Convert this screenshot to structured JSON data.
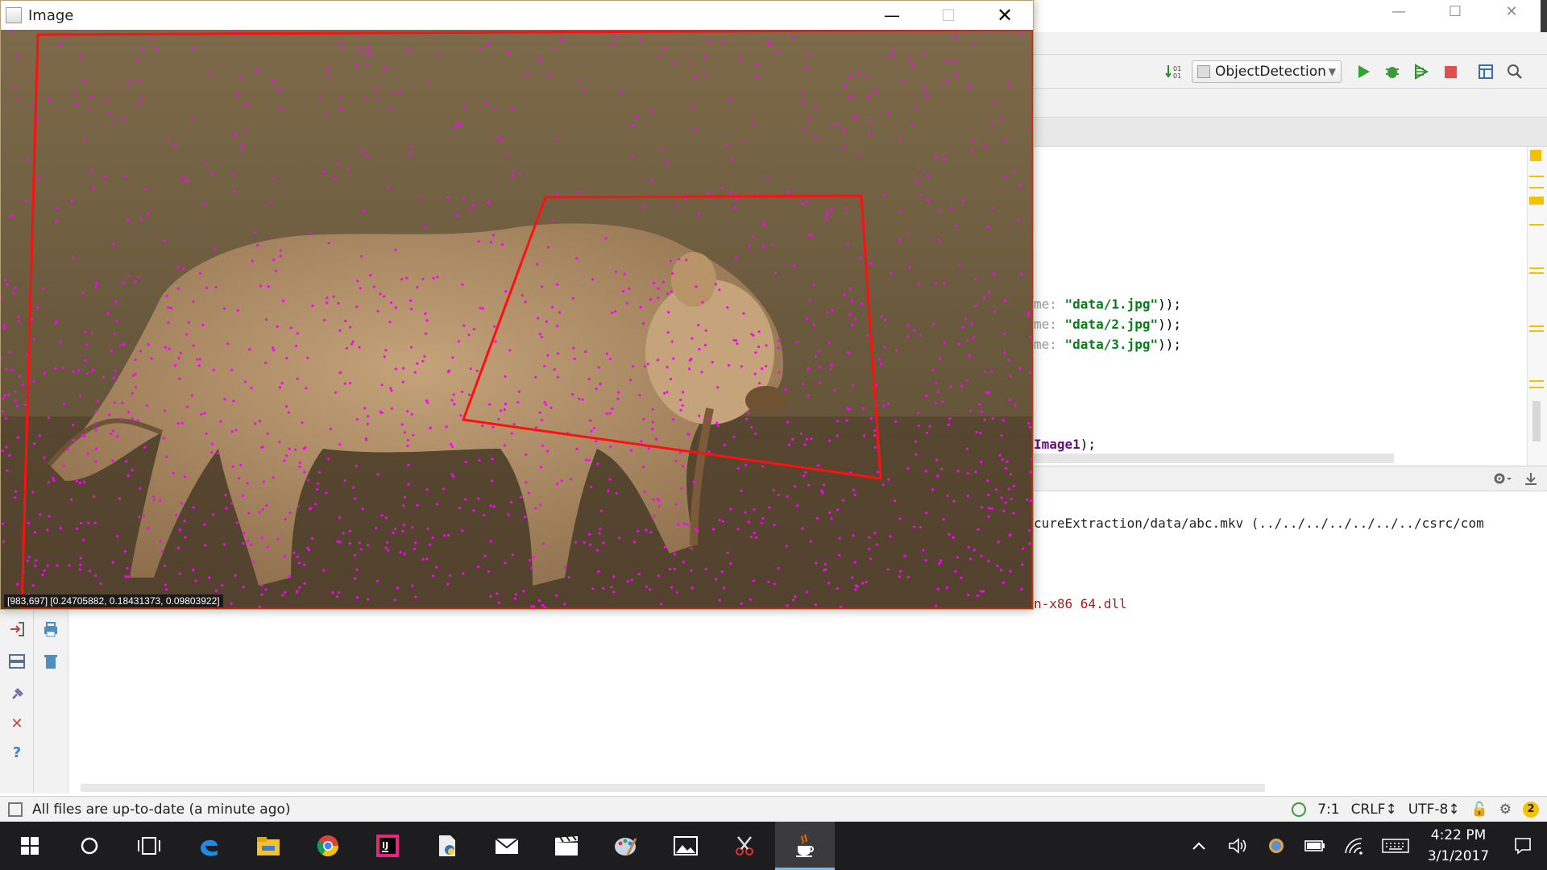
{
  "image_window": {
    "title": "Image",
    "pixel_readout": "[983,697] [0.24705882, 0.18431373, 0.09803922]",
    "photo_subject": "lioness walking on grass with detected keypoints and red bounding quadrilaterals"
  },
  "ide": {
    "run_config": "ObjectDetection",
    "editor_lines": [
      {
        "prefix": "me: ",
        "str": "\"data/1.jpg\"",
        "suffix": "));"
      },
      {
        "prefix": "me: ",
        "str": "\"data/2.jpg\"",
        "suffix": "));"
      },
      {
        "prefix": "me: ",
        "str": "\"data/3.jpg\"",
        "suffix": "));"
      },
      {
        "var": "Image1",
        "suffix": ");"
      }
    ],
    "console_lines": [
      "cureExtraction/data/abc.mkv (../../../../../../../csrc/com",
      "n-x86_64.dll"
    ],
    "status_message": "All files are up-to-date (a minute ago)",
    "status_position": "7:1",
    "status_line_sep": "CRLF↕",
    "status_encoding": "UTF-8↕",
    "notification_count": "2"
  },
  "taskbar": {
    "time": "4:22 PM",
    "date": "3/1/2017",
    "apps": [
      "start",
      "cortana",
      "task-view",
      "edge",
      "file-explorer",
      "chrome",
      "intellij",
      "python-editor",
      "mail",
      "movies",
      "paint",
      "photos",
      "snipping",
      "java"
    ]
  },
  "colors": {
    "keypoint": "#ff00ff",
    "bbox": "#ff1010",
    "taskbar": "#1d1d1f",
    "accent": "#76b9ed"
  }
}
